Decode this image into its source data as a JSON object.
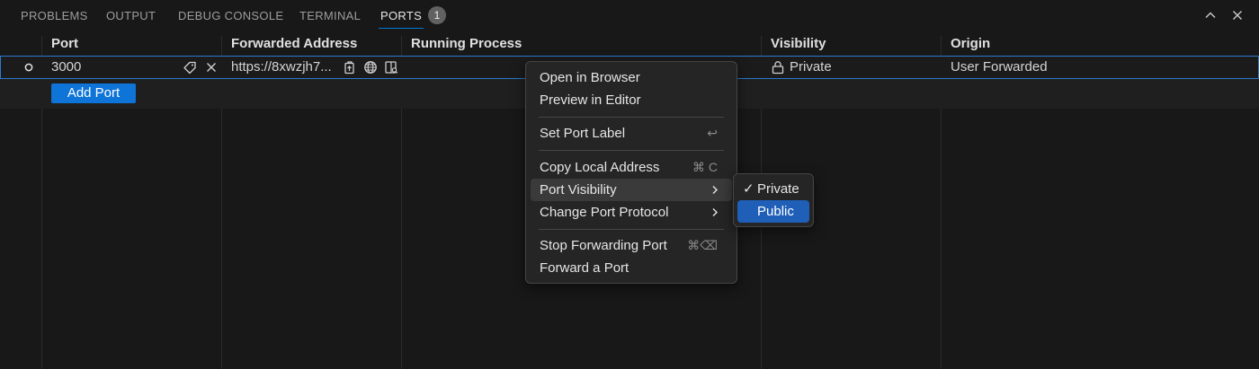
{
  "tabs": [
    {
      "label": "PROBLEMS"
    },
    {
      "label": "OUTPUT"
    },
    {
      "label": "DEBUG CONSOLE"
    },
    {
      "label": "TERMINAL"
    },
    {
      "label": "PORTS",
      "badge": "1",
      "active": true
    }
  ],
  "toolbar": {
    "maximize_icon": "chevron-up-icon",
    "close_icon": "close-icon"
  },
  "table": {
    "headers": [
      "Port",
      "Forwarded Address",
      "Running Process",
      "Visibility",
      "Origin"
    ],
    "rows": [
      {
        "port": "3000",
        "forwarded_address": "https://8xwzjh7...",
        "running_process": "",
        "visibility": "Private",
        "origin": "User Forwarded"
      }
    ],
    "add_port_label": "Add Port"
  },
  "context_menu": {
    "groups": [
      [
        {
          "label": "Open in Browser"
        },
        {
          "label": "Preview in Editor"
        }
      ],
      [
        {
          "label": "Set Port Label",
          "shortcut": "↩"
        }
      ],
      [
        {
          "label": "Copy Local Address",
          "shortcut": "⌘ C"
        },
        {
          "label": "Port Visibility",
          "submenu": true
        },
        {
          "label": "Change Port Protocol",
          "submenu": true
        }
      ],
      [
        {
          "label": "Stop Forwarding Port",
          "shortcut": "⌘⌫"
        },
        {
          "label": "Forward a Port"
        }
      ]
    ]
  },
  "visibility_submenu": {
    "items": [
      {
        "label": "Private",
        "checked": "✓"
      },
      {
        "label": "Public"
      }
    ]
  },
  "colors": {
    "accent": "#0078d4",
    "button": "#0e74d8",
    "selected_item": "#1f5fb8"
  }
}
